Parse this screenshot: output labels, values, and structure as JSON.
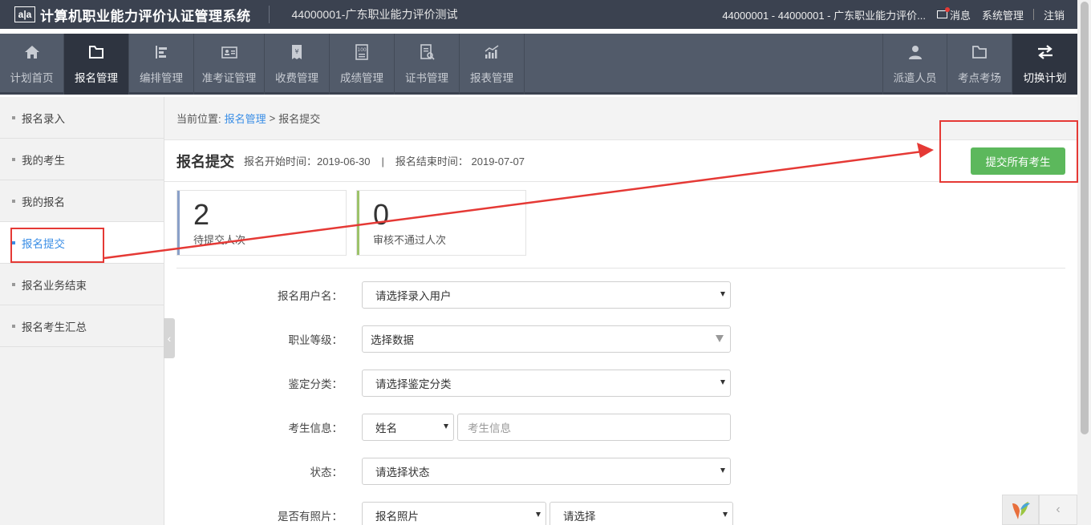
{
  "header": {
    "logo_text": "a|a",
    "app_title": "计算机职业能力评价认证管理系统",
    "org_label": "44000001-广东职业能力评价测试",
    "user_label": "44000001 - 44000001 - 广东职业能力评价...",
    "messages_label": "消息",
    "system_label": "系统管理",
    "logout_label": "注销"
  },
  "nav": {
    "items": [
      {
        "label": "计划首页",
        "icon": "home-icon"
      },
      {
        "label": "报名管理",
        "icon": "folder-icon"
      },
      {
        "label": "编排管理",
        "icon": "schedule-icon"
      },
      {
        "label": "准考证管理",
        "icon": "id-card-icon"
      },
      {
        "label": "收费管理",
        "icon": "receipt-icon"
      },
      {
        "label": "成绩管理",
        "icon": "score-icon"
      },
      {
        "label": "证书管理",
        "icon": "certificate-icon"
      },
      {
        "label": "报表管理",
        "icon": "chart-icon"
      }
    ],
    "right_items": [
      {
        "label": "派遣人员",
        "icon": "person-icon"
      },
      {
        "label": "考点考场",
        "icon": "folder-icon"
      },
      {
        "label": "切换计划",
        "icon": "switch-icon"
      }
    ]
  },
  "sidebar": {
    "items": [
      {
        "label": "报名录入"
      },
      {
        "label": "我的考生"
      },
      {
        "label": "我的报名"
      },
      {
        "label": "报名提交"
      },
      {
        "label": "报名业务结束"
      },
      {
        "label": "报名考生汇总"
      }
    ]
  },
  "breadcrumb": {
    "prefix": "当前位置:",
    "section": "报名管理",
    "separator": ">",
    "current": "报名提交"
  },
  "page": {
    "title": "报名提交",
    "start_label": "报名开始时间：2019-06-30",
    "separator": "|",
    "end_label": "报名结束时间： 2019-07-07",
    "submit_all_label": "提交所有考生"
  },
  "stats": [
    {
      "value": "2",
      "label": "待提交人次",
      "color": "#8aa0c8"
    },
    {
      "value": "0",
      "label": "审核不通过人次",
      "color": "#9dc36a"
    }
  ],
  "form": {
    "user": {
      "label": "报名用户名：",
      "value": "请选择录入用户"
    },
    "level": {
      "label": "职业等级：",
      "value": "选择数据"
    },
    "category": {
      "label": "鉴定分类：",
      "value": "请选择鉴定分类"
    },
    "info": {
      "label": "考生信息：",
      "type_value": "姓名",
      "placeholder": "考生信息"
    },
    "status": {
      "label": "状态：",
      "value": "请选择状态"
    },
    "photo": {
      "label": "是否有照片：",
      "type_value": "报名照片",
      "value": "请选择"
    }
  },
  "colors": {
    "topbar": "#3b4250",
    "navbar": "#525b6a",
    "active": "#2e3440",
    "accent": "#3a8ee6",
    "submit": "#5cb85c",
    "annotation": "#e53935"
  }
}
